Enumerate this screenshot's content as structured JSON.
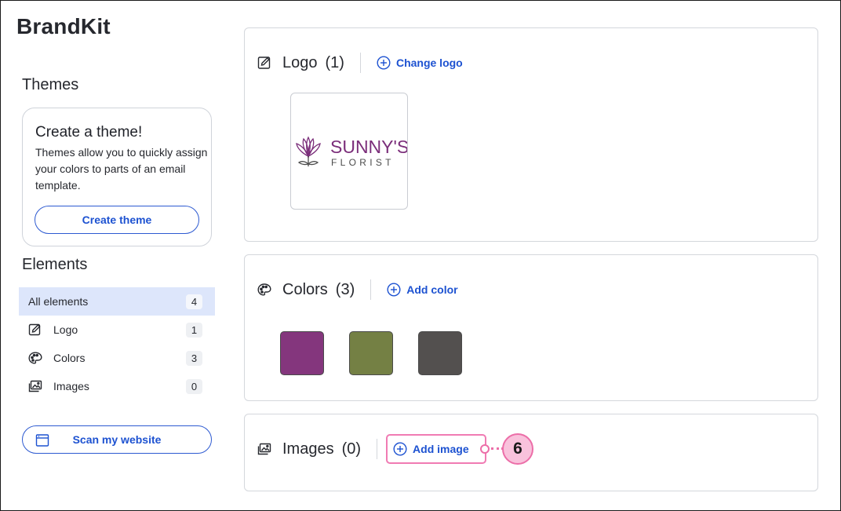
{
  "app": {
    "title": "BrandKit"
  },
  "sidebar": {
    "themes_heading": "Themes",
    "theme_card": {
      "title": "Create a theme!",
      "description": "Themes allow you to quickly assign your colors to parts of an email template.",
      "button_label": "Create theme"
    },
    "elements_heading": "Elements",
    "items": [
      {
        "label": "All elements",
        "count": "4",
        "icon": "",
        "active": true
      },
      {
        "label": "Logo",
        "count": "1",
        "icon": "edit-square-icon",
        "active": false
      },
      {
        "label": "Colors",
        "count": "3",
        "icon": "palette-icon",
        "active": false
      },
      {
        "label": "Images",
        "count": "0",
        "icon": "images-icon",
        "active": false
      }
    ],
    "scan_button_label": "Scan my website"
  },
  "main": {
    "logo_section": {
      "title": "Logo",
      "count": "(1)",
      "action_label": "Change logo",
      "logo_image": {
        "brand_text": "SUNNY'S",
        "sub_text": "FLORIST"
      }
    },
    "colors_section": {
      "title": "Colors",
      "count": "(3)",
      "action_label": "Add color",
      "swatches": [
        "#84367d",
        "#748044",
        "#53504f"
      ]
    },
    "images_section": {
      "title": "Images",
      "count": "(0)",
      "action_label": "Add image"
    }
  },
  "annotation": {
    "step_number": "6",
    "color": "#ec6ea8"
  },
  "colors": {
    "accent": "#1d52d1",
    "active_bg": "#dde6fb",
    "border": "#d4d7dc"
  }
}
